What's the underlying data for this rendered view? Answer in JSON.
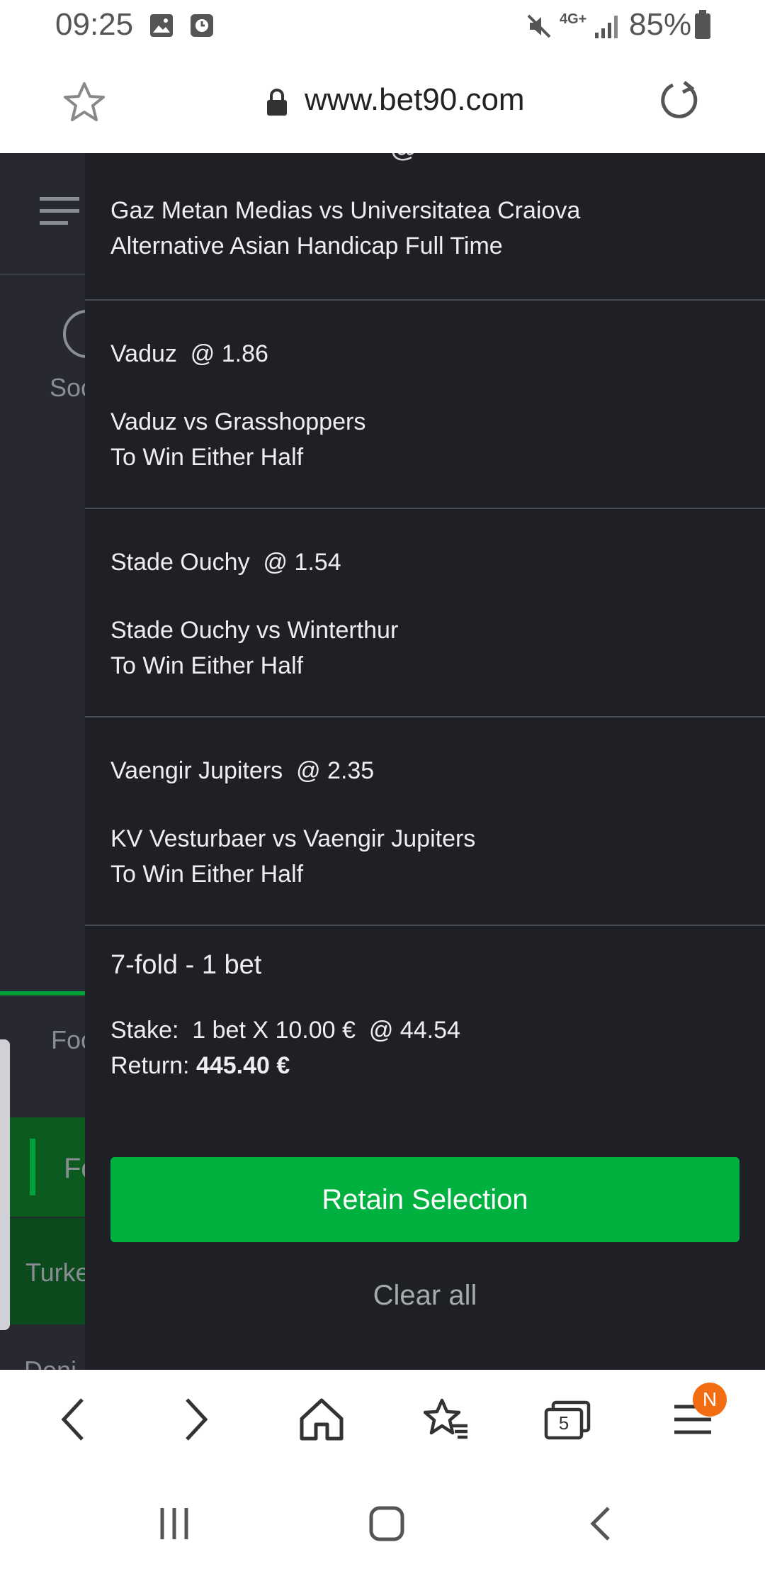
{
  "status_bar": {
    "time": "09:25",
    "network": "4G+",
    "battery": "85%"
  },
  "browser": {
    "url": "www.bet90.com",
    "tabs_count": "5",
    "menu_badge": "N"
  },
  "background": {
    "sport_label": "Soc",
    "tab_label": "Foo",
    "tab_selected": "Fo",
    "league": "Turke",
    "partial": "Deni"
  },
  "betslip": {
    "top_partial": "@",
    "selections": [
      {
        "pick": "",
        "odds": "",
        "match": "Gaz Metan Medias vs Universitatea Craiova",
        "market": "Alternative Asian Handicap Full Time"
      },
      {
        "pick": "Vaduz",
        "odds": "@ 1.86",
        "match": "Vaduz vs Grasshoppers",
        "market": "To Win Either Half"
      },
      {
        "pick": "Stade Ouchy",
        "odds": "@ 1.54",
        "match": "Stade Ouchy vs Winterthur",
        "market": "To Win Either Half"
      },
      {
        "pick": "Vaengir Jupiters",
        "odds": "@ 2.35",
        "match": "KV Vesturbaer vs Vaengir Jupiters",
        "market": "To Win Either Half"
      }
    ],
    "summary": {
      "title": "7-fold - 1 bet",
      "stake_label": "Stake:",
      "stake_value": "1 bet X 10.00 €",
      "total_odds": "@ 44.54",
      "return_label": "Return:",
      "return_value": "445.40 €"
    },
    "retain_label": "Retain Selection",
    "clear_label": "Clear all"
  },
  "colors": {
    "accent": "#00b140",
    "panel_bg": "#1f2026",
    "badge": "#f26c12"
  }
}
